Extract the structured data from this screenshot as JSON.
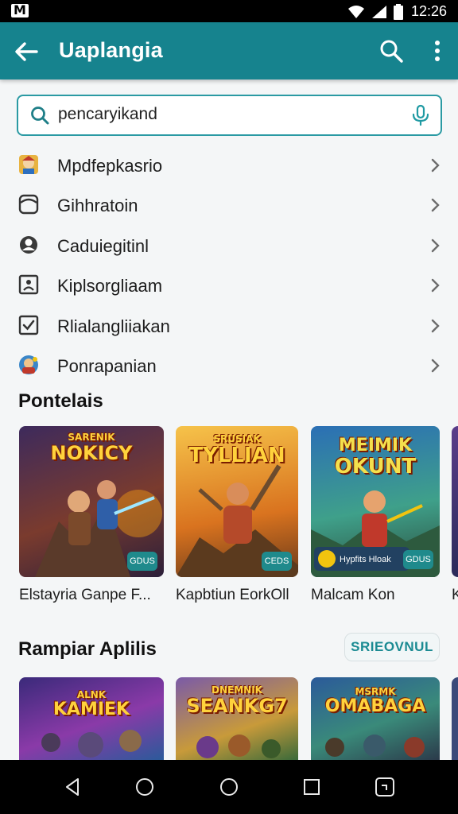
{
  "status": {
    "time": "12:26",
    "app_icon_letter": "M"
  },
  "appbar": {
    "title": "Uaplangia"
  },
  "search": {
    "value": "pencaryikand"
  },
  "categories": [
    {
      "label": "Mpdfepkasrio"
    },
    {
      "label": "Gihhratoin"
    },
    {
      "label": "Caduiegitinl"
    },
    {
      "label": "Kiplsorgliaam"
    },
    {
      "label": "Rlialangliiakan"
    },
    {
      "label": "Ponrapanian"
    }
  ],
  "section1": {
    "title": "Pontelais",
    "cards": [
      {
        "name": "Elstayria Ganpe F...",
        "art_sub": "SARENIK",
        "art_title": "NOKICY",
        "badge": "GDUS"
      },
      {
        "name": "Kapbtiun EorkOll",
        "art_sub": "SRUSIAK",
        "art_title": "TYLLIAN",
        "badge": "CEDS"
      },
      {
        "name": "Malcam Kon",
        "art_sub": "MEIMIK",
        "art_title": "OKUNT",
        "badge": "GDUS",
        "tag": "Hypfits Hloak"
      },
      {
        "name": "K"
      }
    ]
  },
  "section2": {
    "title": "Rampiar Aplilis",
    "button": "SRIEOVNUL",
    "cards": [
      {
        "art_sub": "ALNK",
        "art_title": "KAMIEK"
      },
      {
        "art_sub": "DNEMNIK",
        "art_title": "SEANKG7"
      },
      {
        "art_sub": "MSRMK",
        "art_title": "OMABAGA"
      }
    ]
  },
  "colors": {
    "appbar": "#16838e",
    "accent": "#2a9aa3",
    "nav": "#000000"
  }
}
